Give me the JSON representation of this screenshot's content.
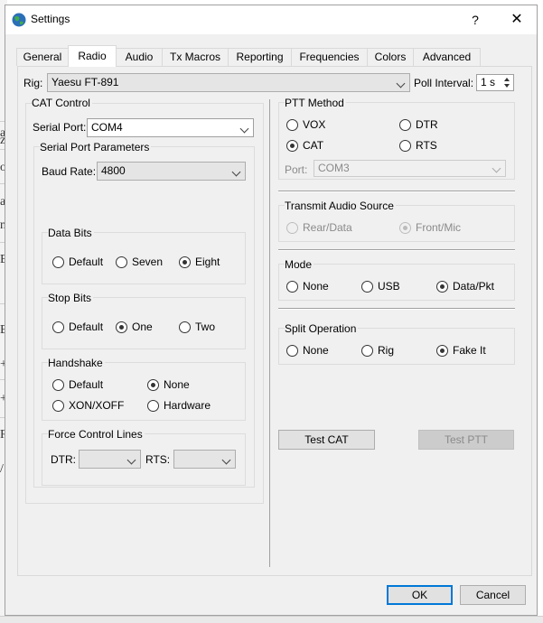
{
  "window": {
    "title": "Settings",
    "help_label": "?",
    "close_label": "✕",
    "icon": "app-globe-icon"
  },
  "tabs": [
    {
      "label": "General"
    },
    {
      "label": "Radio",
      "active": true
    },
    {
      "label": "Audio"
    },
    {
      "label": "Tx Macros"
    },
    {
      "label": "Reporting"
    },
    {
      "label": "Frequencies"
    },
    {
      "label": "Colors"
    },
    {
      "label": "Advanced"
    }
  ],
  "rig": {
    "label": "Rig:",
    "value": "Yaesu FT-891"
  },
  "poll": {
    "label": "Poll Interval:",
    "value": "1 s"
  },
  "cat": {
    "title": "CAT Control",
    "serial_port": {
      "label": "Serial Port:",
      "value": "COM4"
    },
    "params": {
      "title": "Serial Port Parameters",
      "baud": {
        "label": "Baud Rate:",
        "value": "4800"
      },
      "data_bits": {
        "title": "Data Bits",
        "options": [
          "Default",
          "Seven",
          "Eight"
        ],
        "selected": "Eight"
      },
      "stop_bits": {
        "title": "Stop Bits",
        "options": [
          "Default",
          "One",
          "Two"
        ],
        "selected": "One"
      },
      "handshake": {
        "title": "Handshake",
        "options": [
          "Default",
          "None",
          "XON/XOFF",
          "Hardware"
        ],
        "selected": "None"
      },
      "force": {
        "title": "Force Control Lines",
        "dtr_label": "DTR:",
        "rts_label": "RTS:",
        "dtr_value": "",
        "rts_value": ""
      }
    }
  },
  "ptt": {
    "title": "PTT Method",
    "options": [
      "VOX",
      "DTR",
      "CAT",
      "RTS"
    ],
    "selected": "CAT",
    "port_label": "Port:",
    "port_value": "COM3"
  },
  "audio_source": {
    "title": "Transmit Audio Source",
    "options": [
      "Rear/Data",
      "Front/Mic"
    ],
    "selected": "Front/Mic",
    "disabled": true
  },
  "mode": {
    "title": "Mode",
    "options": [
      "None",
      "USB",
      "Data/Pkt"
    ],
    "selected": "Data/Pkt"
  },
  "split": {
    "title": "Split Operation",
    "options": [
      "None",
      "Rig",
      "Fake It"
    ],
    "selected": "Fake It"
  },
  "buttons": {
    "test_cat": "Test CAT",
    "test_ptt": "Test PTT",
    "ok": "OK",
    "cancel": "Cancel"
  },
  "background_glyphs": [
    "a",
    "z",
    "os",
    "a",
    "n",
    "E",
    "E",
    "+",
    "+",
    "R",
    "/"
  ],
  "colors": {
    "accent": "#0078d7",
    "dialog_bg": "#f0f0f0"
  }
}
